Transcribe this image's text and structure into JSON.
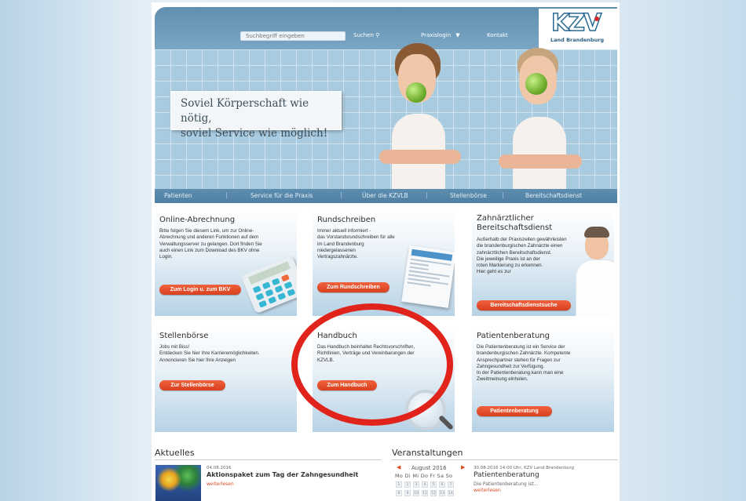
{
  "header": {
    "search_placeholder": "Suchbegriff eingeben",
    "search_label": "Suchen",
    "practice_login": "Praxislogin",
    "contact": "Kontakt",
    "logo_text": "KZV",
    "logo_sub": "Land Brandenburg"
  },
  "hero": {
    "tagline_line1": "Soviel Körperschaft wie nötig,",
    "tagline_line2": "soviel Service wie möglich!"
  },
  "nav": [
    "Patienten",
    "Service für die Praxis",
    "Über die KZVLB",
    "Stellenbörse",
    "Bereitschaftsdienst"
  ],
  "boxes": {
    "online": {
      "title": "Online-Abrechnung",
      "lines": [
        "Bitte folgen Sie diesem Link, um zur Online-",
        "Abrechnung und anderen Funktionen auf dem",
        "Verwaltungsserver zu gelangen. Dort finden Sie",
        "auch einen Link zum Download des BKV ohne",
        "Login."
      ],
      "button": "Zum Login u. zum BKV"
    },
    "rundschreiben": {
      "title": "Rundschreiben",
      "lines": [
        "Immer aktuell informiert -",
        "das Vorstandsrundschreiben für alle",
        "im Land Brandenburg",
        "niedergelassenen",
        "Vertragszahnärzte."
      ],
      "button": "Zum Rundschreiben"
    },
    "bereitschaft": {
      "title_line1": "Zahnärztlicher",
      "title_line2": "Bereitschaftsdienst",
      "lines": [
        "Außerhalb der Praxiszeiten gewährleisten",
        "die brandenburgischen Zahnärzte einen",
        "zahnärztlichen Bereitschaftsdienst.",
        "Die jeweilige Praxis ist an der",
        "roten Markierung zu erkennen.",
        "Hier geht es zur"
      ],
      "button": "Bereitschaftsdienstsuche"
    },
    "stellen": {
      "title": "Stellenbörse",
      "lines": [
        "Jobs mit Biss!",
        "Entdecken Sie hier Ihre Karrieremöglichkeiten.",
        "Annoncieren Sie hier Ihre Anzeigen"
      ],
      "button": "Zur Stellenbörse"
    },
    "handbuch": {
      "title": "Handbuch",
      "lines": [
        "Das Handbuch beinhaltet Rechtsvorschriften,",
        "Richtlinien, Verträge und Vereinbarungen der",
        "KZVLB."
      ],
      "button": "Zum Handbuch"
    },
    "patient": {
      "title": "Patientenberatung",
      "lines": [
        "Die Patientenberatung ist ein Service der",
        "brandenburgischen Zahnärzte. Kompetente",
        "Ansprechpartner stehen für Fragen zur",
        "Zahngesundheit zur Verfügung.",
        "In der Patientenberatung kann man eine",
        "Zweitmeinung einholen."
      ],
      "button": "Patientenberatung"
    }
  },
  "news": {
    "title": "Aktuelles",
    "date": "04.08.2016",
    "headline": "Aktionspaket zum Tag der Zahngesundheit",
    "more": "weiterlesen"
  },
  "events": {
    "title": "Veranstaltungen",
    "month": "August 2016",
    "weekdays": "Mo Di Mi Do Fr Sa So",
    "row1": [
      "1",
      "2",
      "3",
      "4",
      "5",
      "6",
      "7"
    ],
    "row2": [
      "8",
      "9",
      "10",
      "11",
      "12",
      "13",
      "14"
    ],
    "event_meta": "30.08.2016 14:00 Uhr, KZV Land Brandenburg",
    "event_title": "Patientenberatung",
    "event_desc": "Die Patientenberatung ist...",
    "more": "weiterlesen"
  },
  "colors": {
    "accent": "#e04b24",
    "header_blue": "#6a98b8",
    "highlight_ring": "#e0241c"
  }
}
